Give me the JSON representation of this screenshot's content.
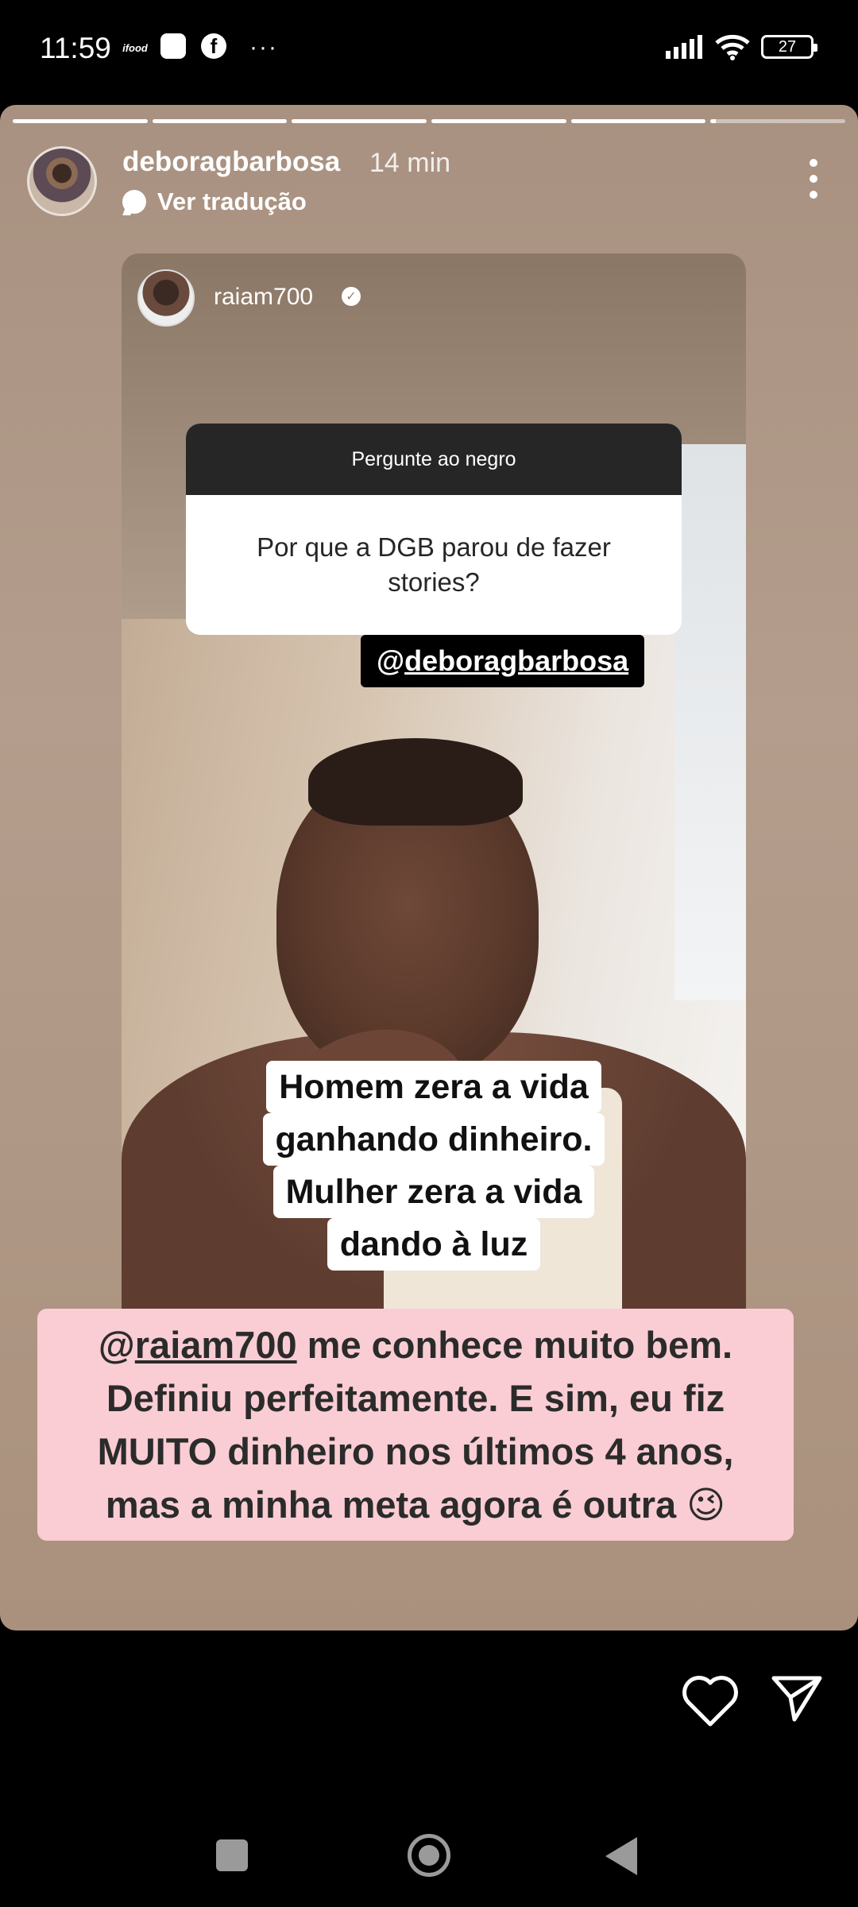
{
  "status_bar": {
    "time": "11:59",
    "ifood_label": "ifood",
    "fb_label": "f",
    "more_label": "···",
    "battery": "27"
  },
  "story": {
    "progress": [
      1,
      1,
      1,
      1,
      1,
      0.04
    ],
    "username": "deboragbarbosa",
    "time_ago": "14 min",
    "translate_label": "Ver tradução"
  },
  "embedded_story": {
    "username": "raiam700",
    "verified_mark": "✓",
    "question_title": "Pergunte ao negro",
    "question_text": "Por que a DGB parou de fazer stories?",
    "mention_prefix": "@",
    "mention_user": "deboragbarbosa",
    "caption": [
      "Homem zera a vida",
      "ganhando dinheiro.",
      "Mulher zera a vida",
      "dando à luz"
    ]
  },
  "overlay": {
    "mention_prefix": "@",
    "mention_user": "raiam700",
    "line1_rest": " me conhece muito bem.",
    "line2": "Definiu perfeitamente. E sim, eu fiz",
    "line3": "MUITO dinheiro nos últimos 4 anos,",
    "line4": "mas a minha meta agora é outra 😉"
  },
  "colors": {
    "overlay_bg": "#f9cdd3",
    "story_bg": "#a89180"
  }
}
